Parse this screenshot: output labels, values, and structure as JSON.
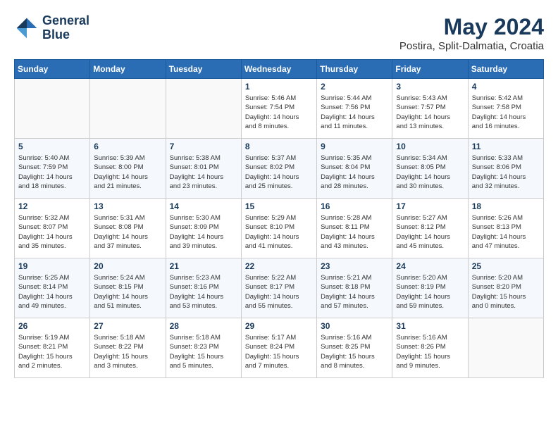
{
  "header": {
    "logo_line1": "General",
    "logo_line2": "Blue",
    "month": "May 2024",
    "location": "Postira, Split-Dalmatia, Croatia"
  },
  "weekdays": [
    "Sunday",
    "Monday",
    "Tuesday",
    "Wednesday",
    "Thursday",
    "Friday",
    "Saturday"
  ],
  "weeks": [
    [
      {
        "day": "",
        "info": ""
      },
      {
        "day": "",
        "info": ""
      },
      {
        "day": "",
        "info": ""
      },
      {
        "day": "1",
        "info": "Sunrise: 5:46 AM\nSunset: 7:54 PM\nDaylight: 14 hours\nand 8 minutes."
      },
      {
        "day": "2",
        "info": "Sunrise: 5:44 AM\nSunset: 7:56 PM\nDaylight: 14 hours\nand 11 minutes."
      },
      {
        "day": "3",
        "info": "Sunrise: 5:43 AM\nSunset: 7:57 PM\nDaylight: 14 hours\nand 13 minutes."
      },
      {
        "day": "4",
        "info": "Sunrise: 5:42 AM\nSunset: 7:58 PM\nDaylight: 14 hours\nand 16 minutes."
      }
    ],
    [
      {
        "day": "5",
        "info": "Sunrise: 5:40 AM\nSunset: 7:59 PM\nDaylight: 14 hours\nand 18 minutes."
      },
      {
        "day": "6",
        "info": "Sunrise: 5:39 AM\nSunset: 8:00 PM\nDaylight: 14 hours\nand 21 minutes."
      },
      {
        "day": "7",
        "info": "Sunrise: 5:38 AM\nSunset: 8:01 PM\nDaylight: 14 hours\nand 23 minutes."
      },
      {
        "day": "8",
        "info": "Sunrise: 5:37 AM\nSunset: 8:02 PM\nDaylight: 14 hours\nand 25 minutes."
      },
      {
        "day": "9",
        "info": "Sunrise: 5:35 AM\nSunset: 8:04 PM\nDaylight: 14 hours\nand 28 minutes."
      },
      {
        "day": "10",
        "info": "Sunrise: 5:34 AM\nSunset: 8:05 PM\nDaylight: 14 hours\nand 30 minutes."
      },
      {
        "day": "11",
        "info": "Sunrise: 5:33 AM\nSunset: 8:06 PM\nDaylight: 14 hours\nand 32 minutes."
      }
    ],
    [
      {
        "day": "12",
        "info": "Sunrise: 5:32 AM\nSunset: 8:07 PM\nDaylight: 14 hours\nand 35 minutes."
      },
      {
        "day": "13",
        "info": "Sunrise: 5:31 AM\nSunset: 8:08 PM\nDaylight: 14 hours\nand 37 minutes."
      },
      {
        "day": "14",
        "info": "Sunrise: 5:30 AM\nSunset: 8:09 PM\nDaylight: 14 hours\nand 39 minutes."
      },
      {
        "day": "15",
        "info": "Sunrise: 5:29 AM\nSunset: 8:10 PM\nDaylight: 14 hours\nand 41 minutes."
      },
      {
        "day": "16",
        "info": "Sunrise: 5:28 AM\nSunset: 8:11 PM\nDaylight: 14 hours\nand 43 minutes."
      },
      {
        "day": "17",
        "info": "Sunrise: 5:27 AM\nSunset: 8:12 PM\nDaylight: 14 hours\nand 45 minutes."
      },
      {
        "day": "18",
        "info": "Sunrise: 5:26 AM\nSunset: 8:13 PM\nDaylight: 14 hours\nand 47 minutes."
      }
    ],
    [
      {
        "day": "19",
        "info": "Sunrise: 5:25 AM\nSunset: 8:14 PM\nDaylight: 14 hours\nand 49 minutes."
      },
      {
        "day": "20",
        "info": "Sunrise: 5:24 AM\nSunset: 8:15 PM\nDaylight: 14 hours\nand 51 minutes."
      },
      {
        "day": "21",
        "info": "Sunrise: 5:23 AM\nSunset: 8:16 PM\nDaylight: 14 hours\nand 53 minutes."
      },
      {
        "day": "22",
        "info": "Sunrise: 5:22 AM\nSunset: 8:17 PM\nDaylight: 14 hours\nand 55 minutes."
      },
      {
        "day": "23",
        "info": "Sunrise: 5:21 AM\nSunset: 8:18 PM\nDaylight: 14 hours\nand 57 minutes."
      },
      {
        "day": "24",
        "info": "Sunrise: 5:20 AM\nSunset: 8:19 PM\nDaylight: 14 hours\nand 59 minutes."
      },
      {
        "day": "25",
        "info": "Sunrise: 5:20 AM\nSunset: 8:20 PM\nDaylight: 15 hours\nand 0 minutes."
      }
    ],
    [
      {
        "day": "26",
        "info": "Sunrise: 5:19 AM\nSunset: 8:21 PM\nDaylight: 15 hours\nand 2 minutes."
      },
      {
        "day": "27",
        "info": "Sunrise: 5:18 AM\nSunset: 8:22 PM\nDaylight: 15 hours\nand 3 minutes."
      },
      {
        "day": "28",
        "info": "Sunrise: 5:18 AM\nSunset: 8:23 PM\nDaylight: 15 hours\nand 5 minutes."
      },
      {
        "day": "29",
        "info": "Sunrise: 5:17 AM\nSunset: 8:24 PM\nDaylight: 15 hours\nand 7 minutes."
      },
      {
        "day": "30",
        "info": "Sunrise: 5:16 AM\nSunset: 8:25 PM\nDaylight: 15 hours\nand 8 minutes."
      },
      {
        "day": "31",
        "info": "Sunrise: 5:16 AM\nSunset: 8:26 PM\nDaylight: 15 hours\nand 9 minutes."
      },
      {
        "day": "",
        "info": ""
      }
    ]
  ]
}
